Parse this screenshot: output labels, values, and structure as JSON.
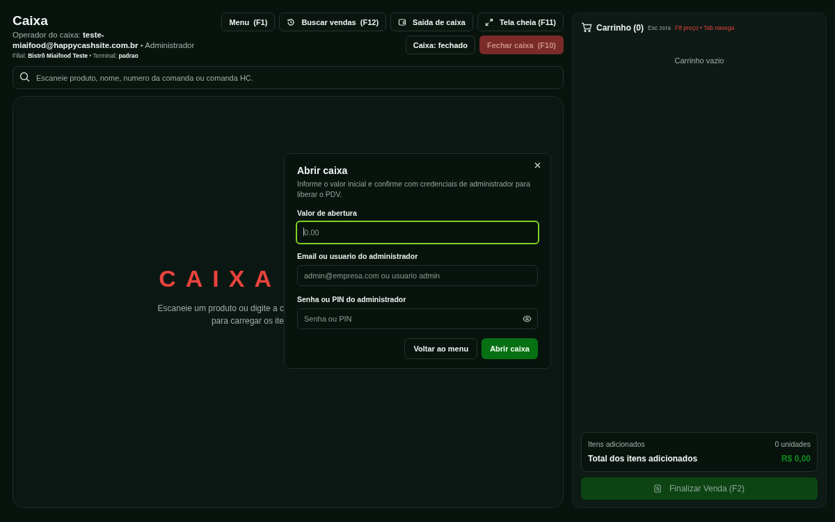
{
  "header": {
    "title": "Caixa",
    "operator": "Operador do caixa: **teste-miaifood@happycashsite.com.br** • Administrador",
    "branch": "Filial: **Bistrô Miaifood Teste** • Terminal: **padrao**"
  },
  "toolbar": [
    {
      "label": "Menu  (F1)",
      "kind": "plain"
    },
    {
      "label": "Buscar vendas  (F12)",
      "kind": "history"
    },
    {
      "label": "Saída de caixa",
      "kind": "wallet"
    },
    {
      "label": "Tela cheia (F11)",
      "kind": "expand"
    }
  ],
  "status_button": {
    "label": "Caixa: fechado"
  },
  "close_button": {
    "label": "Fechar caixa  (F10)",
    "disabled": true
  },
  "search": {
    "placeholder": "Escaneie produto, nome, numero da comanda ou comanda HC."
  },
  "hero": {
    "title": "CAIXA",
    "hint": "Escaneie um produto ou digite a c",
    "hint_2": "para carregar os ite"
  },
  "modal": {
    "title": "Abrir caixa",
    "description": "Informe o valor inicial e confirme com credenciais de administrador para liberar o PDV.",
    "fields": [
      {
        "label": "Valor de abertura",
        "placeholder": "0.00",
        "focused": true,
        "kind": "text"
      },
      {
        "label": "Email ou usuario do administrador",
        "placeholder": "admin@empresa.com ou usuario admin",
        "focused": false,
        "kind": "text"
      },
      {
        "label": "Senha ou PIN do administrador",
        "placeholder": "Senha ou PIN",
        "focused": false,
        "kind": "password"
      }
    ],
    "buttons": [
      {
        "label": "Voltar ao menu",
        "kind": "secondary"
      },
      {
        "label": "Abrir caixa",
        "kind": "primary"
      }
    ]
  },
  "cart": {
    "title": "Carrinho (0)",
    "hint": "Esc zera",
    "shortcuts": "F8 preço • Tab navega",
    "empty": "Carrinho vazio",
    "items_label": "Itens adicionados",
    "items_count": "0 unidades",
    "total_label": "Total dos itens adicionados",
    "total": "R$ 0,00",
    "checkout": {
      "label": "Finalizar Venda (F2)",
      "disabled": true
    }
  }
}
